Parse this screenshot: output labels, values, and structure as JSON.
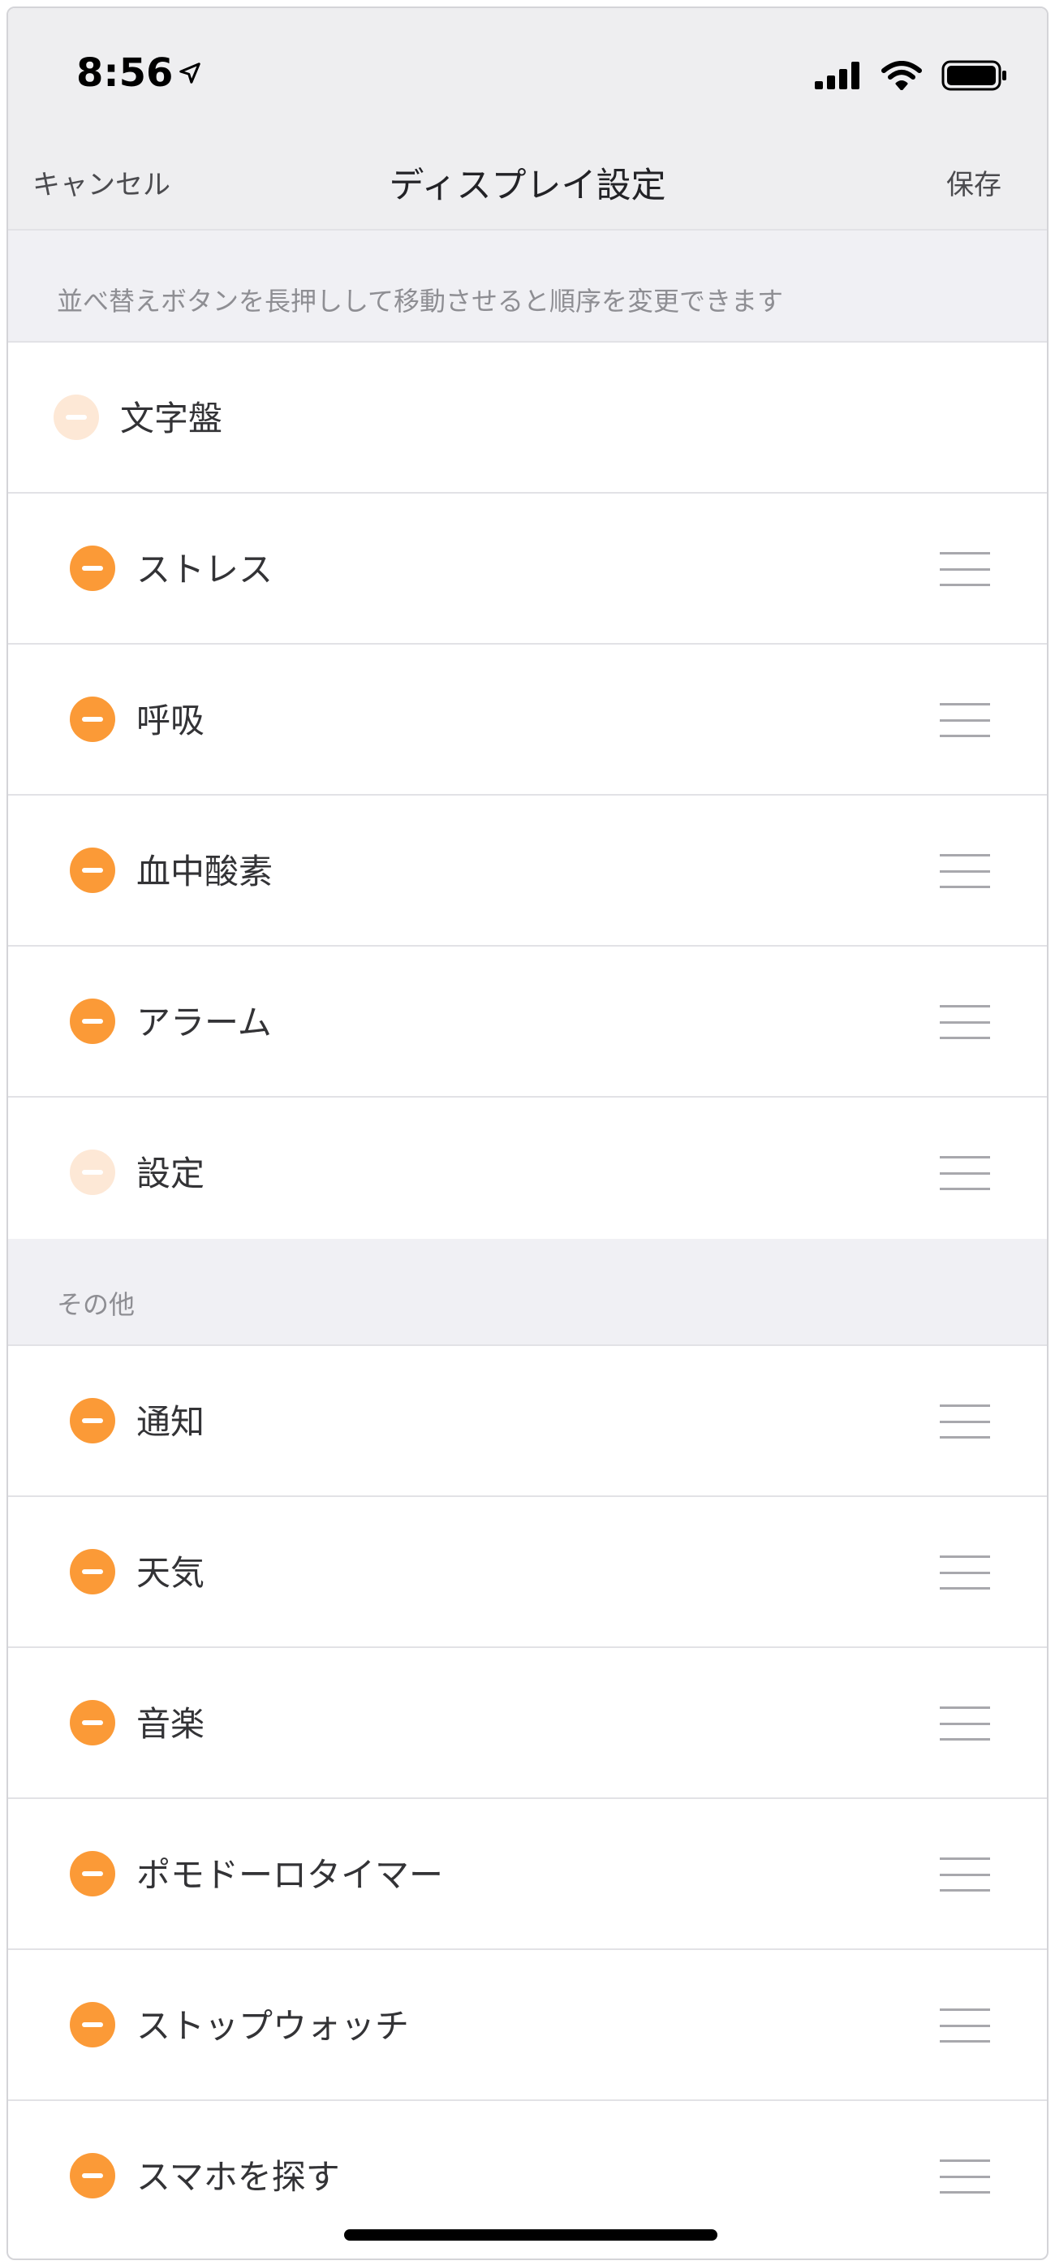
{
  "status_bar": {
    "time": "8:56",
    "location_icon": "location-arrow-icon",
    "signal_icon": "cellular-signal-icon",
    "wifi_icon": "wifi-icon",
    "battery_icon": "battery-icon"
  },
  "nav": {
    "cancel": "キャンセル",
    "title": "ディスプレイ設定",
    "save": "保存"
  },
  "hint": "並べ替えボタンを長押しして移動させると順序を変更できます",
  "items": [
    {
      "label": "文字盤",
      "removable": false,
      "reorderable": false
    },
    {
      "label": "ストレス",
      "removable": true,
      "reorderable": true
    },
    {
      "label": "呼吸",
      "removable": true,
      "reorderable": true
    },
    {
      "label": "血中酸素",
      "removable": true,
      "reorderable": true
    },
    {
      "label": "アラーム",
      "removable": true,
      "reorderable": true
    },
    {
      "label": "設定",
      "removable": false,
      "reorderable": true
    }
  ],
  "other_header": "その他",
  "other_items": [
    {
      "label": "通知",
      "removable": true,
      "reorderable": true
    },
    {
      "label": "天気",
      "removable": true,
      "reorderable": true
    },
    {
      "label": "音楽",
      "removable": true,
      "reorderable": true
    },
    {
      "label": "ポモドーロタイマー",
      "removable": true,
      "reorderable": true
    },
    {
      "label": "ストップウォッチ",
      "removable": true,
      "reorderable": true
    },
    {
      "label": "スマホを探す",
      "removable": true,
      "reorderable": true
    }
  ],
  "colors": {
    "accent": "#fb9a37",
    "accent_disabled": "#fde8d6",
    "background": "#f0f0f4"
  }
}
